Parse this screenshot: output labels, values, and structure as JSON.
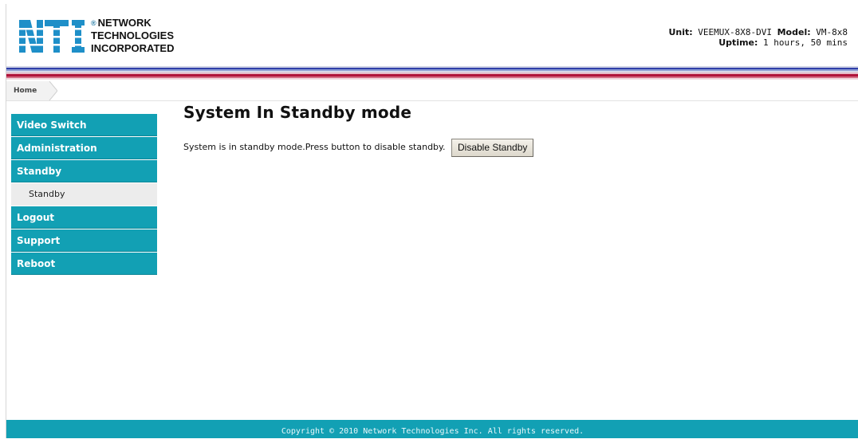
{
  "header": {
    "logo_text": {
      "line1": "NETWORK",
      "line2": "TECHNOLOGIES",
      "line3": "INCORPORATED",
      "registered": "®",
      "mark": "NTI"
    },
    "unit_label": "Unit:",
    "unit_value": "VEEMUX-8X8-DVI",
    "model_label": "Model:",
    "model_value": "VM-8x8",
    "uptime_label": "Uptime:",
    "uptime_value": "1 hours, 50 mins"
  },
  "breadcrumb": {
    "home": "Home"
  },
  "sidebar": {
    "items": [
      {
        "label": "Video Switch"
      },
      {
        "label": "Administration"
      },
      {
        "label": "Standby"
      },
      {
        "label": "Standby"
      },
      {
        "label": "Logout"
      },
      {
        "label": "Support"
      },
      {
        "label": "Reboot"
      }
    ]
  },
  "main": {
    "title": "System In Standby mode",
    "message": "System is in standby mode.Press button to disable standby.",
    "button_label": "Disable Standby"
  },
  "footer": {
    "copyright": "Copyright © 2010 Network Technologies Inc. All rights reserved."
  },
  "colors": {
    "accent": "#12a0b4",
    "stripe_blue": "#2f3ea8",
    "stripe_red": "#b0123a",
    "logo_blue": "#1e8fc8"
  }
}
